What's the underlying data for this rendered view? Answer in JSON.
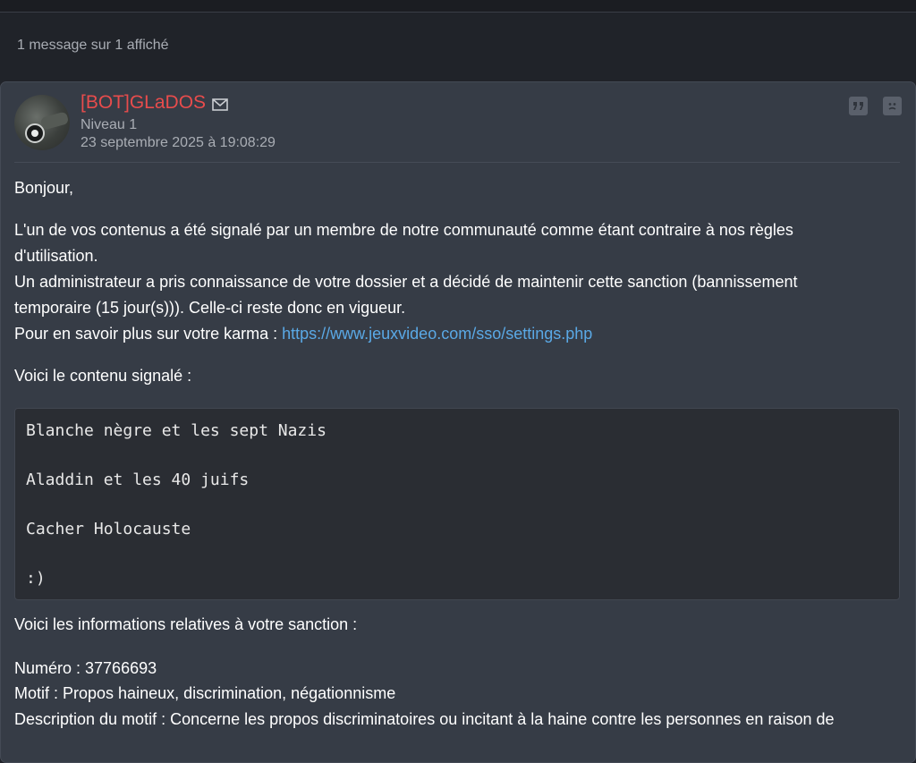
{
  "header": {
    "count_text": "1 message sur 1 affiché"
  },
  "post": {
    "author": "[BOT]GLaDOS",
    "level": "Niveau 1",
    "date": "23 septembre 2025 à 19:08:29",
    "icons": [
      "mail-icon",
      "quote-icon",
      "report-icon"
    ],
    "body": {
      "greeting": "Bonjour,",
      "p1_line1": "L'un de vos contenus a été signalé par un membre de notre communauté comme étant contraire à nos règles",
      "p1_line2": "d'utilisation.",
      "p1_line3": "Un administrateur a pris connaissance de votre dossier et a décidé de maintenir cette sanction (bannissement",
      "p1_line4": "temporaire (15 jour(s))). Celle-ci reste donc en vigueur.",
      "p1_line5_prefix": "Pour en savoir plus sur votre karma : ",
      "karma_link": "https://www.jeuxvideo.com/sso/settings.php",
      "reported_intro": "Voici le contenu signalé :",
      "quoted_lines": [
        "Blanche nègre et les sept Nazis",
        "Aladdin et les 40 juifs",
        "Cacher Holocauste",
        ":)"
      ],
      "sanction_intro": "Voici les informations relatives à votre sanction :",
      "numero": "Numéro : 37766693",
      "motif": "Motif : Propos haineux, discrimination, négationnisme",
      "description": "Description du motif : Concerne les propos discriminatoires ou incitant à la haine contre les personnes en raison de"
    }
  },
  "colors": {
    "author": "#e84c4c",
    "link": "#5aa9e6",
    "background": "#202329",
    "card": "#363c46"
  }
}
